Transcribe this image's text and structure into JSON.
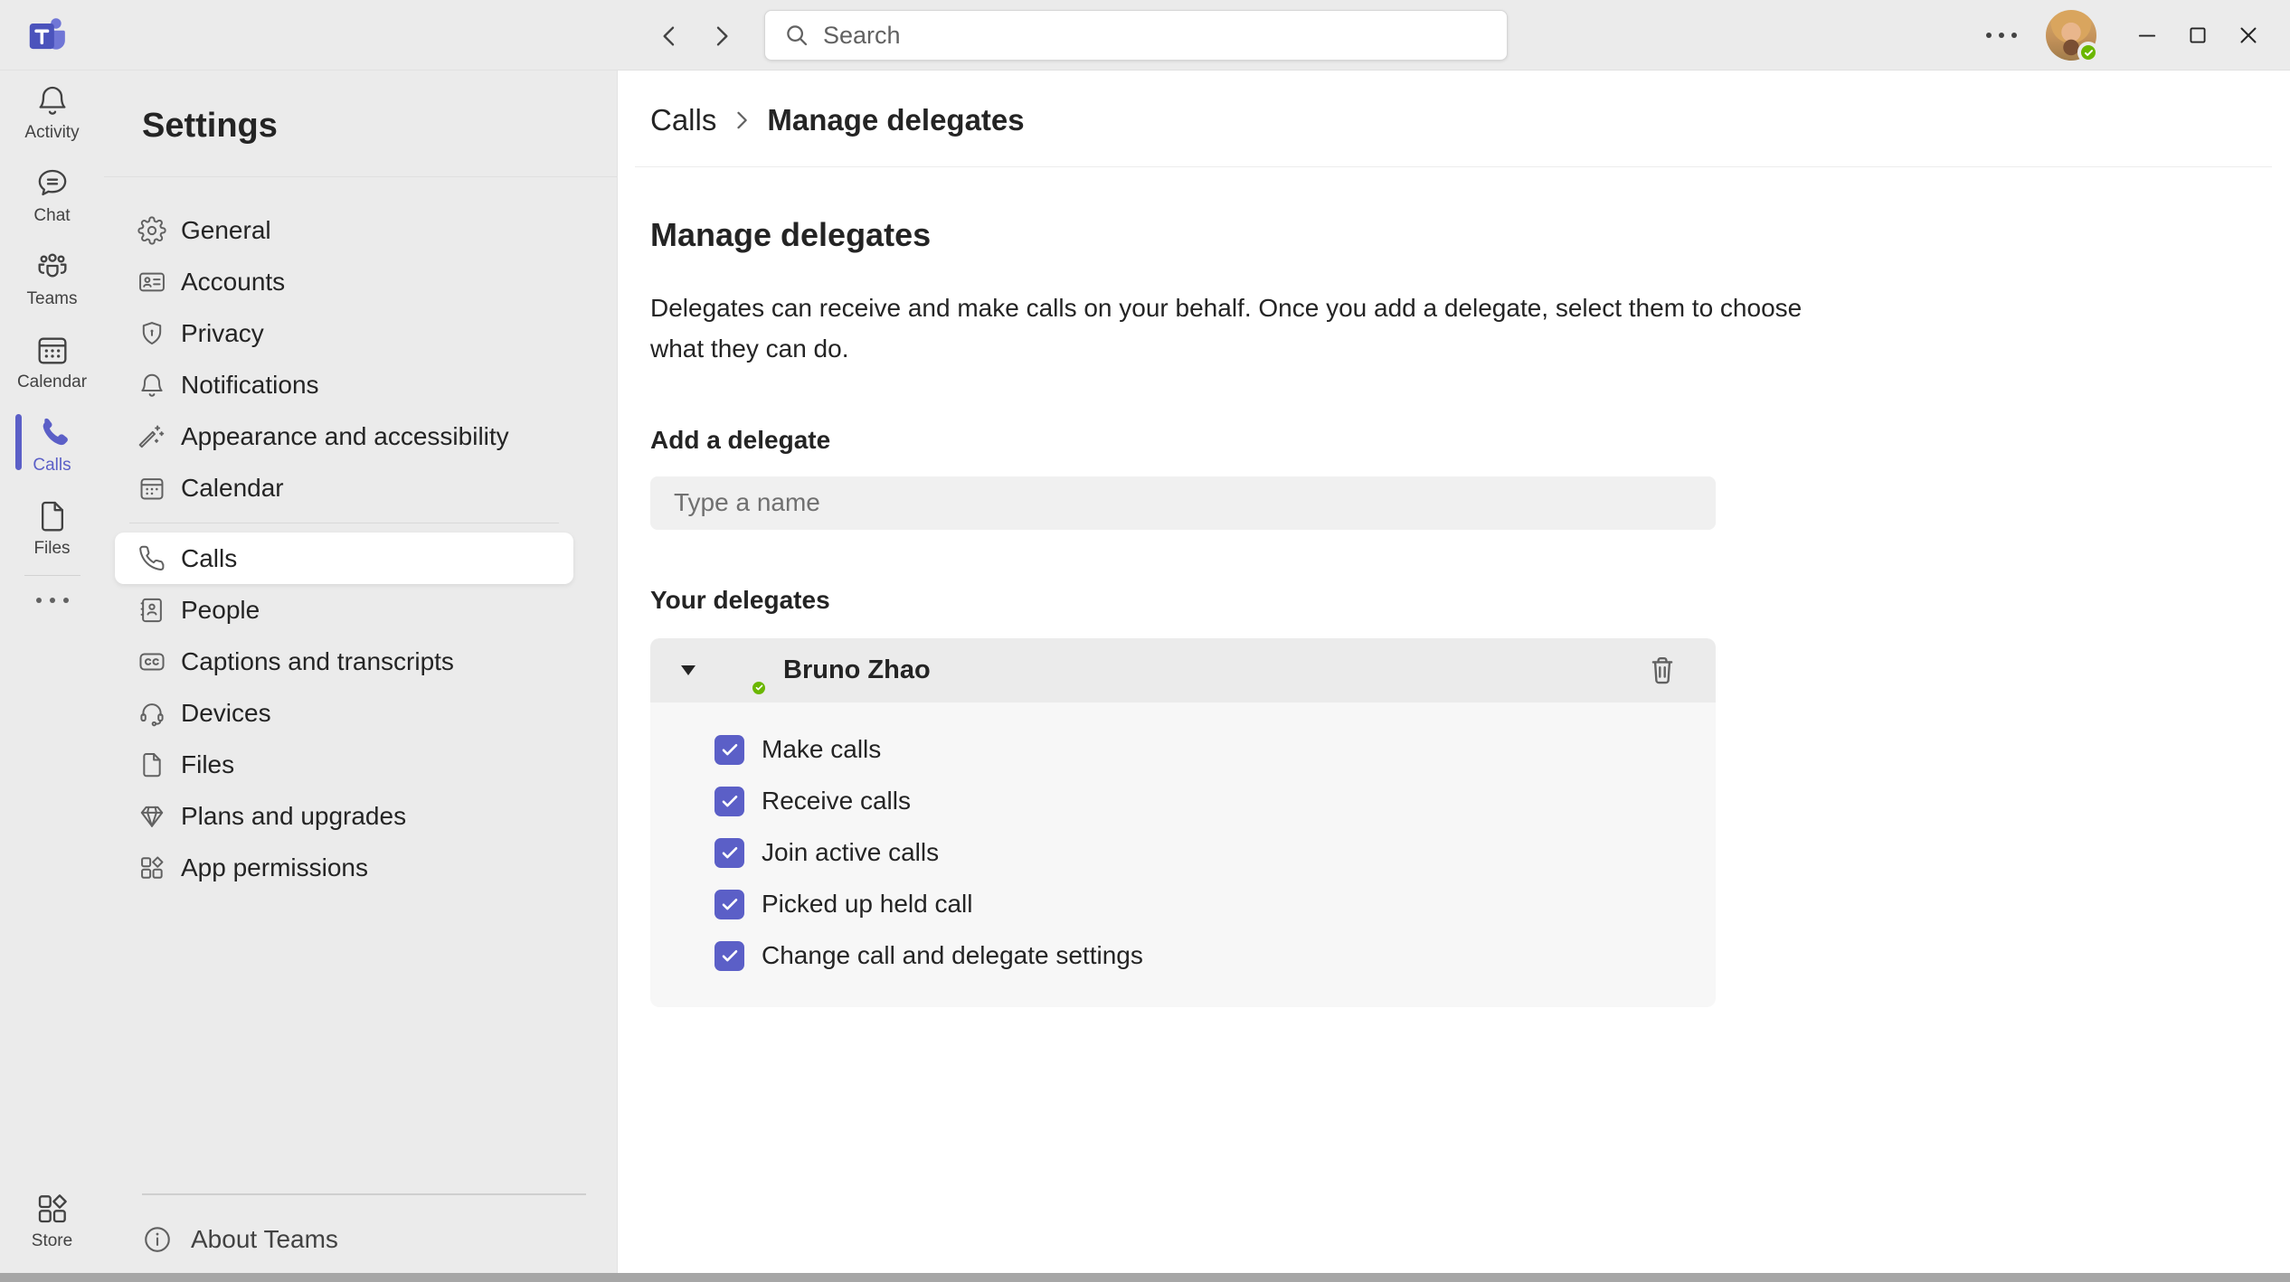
{
  "topbar": {
    "search_placeholder": "Search",
    "search_value": ""
  },
  "rail": {
    "items": [
      {
        "label": "Activity",
        "icon": "bell-icon",
        "active": false
      },
      {
        "label": "Chat",
        "icon": "chat-bubble-icon",
        "active": false
      },
      {
        "label": "Teams",
        "icon": "people-group-icon",
        "active": false
      },
      {
        "label": "Calendar",
        "icon": "calendar-icon",
        "active": false
      },
      {
        "label": "Calls",
        "icon": "phone-filled-icon",
        "active": true
      },
      {
        "label": "Files",
        "icon": "document-icon",
        "active": false
      }
    ],
    "store_label": "Store"
  },
  "settings": {
    "title": "Settings",
    "nav_primary": [
      {
        "label": "General",
        "icon": "gear-icon"
      },
      {
        "label": "Accounts",
        "icon": "id-card-icon"
      },
      {
        "label": "Privacy",
        "icon": "shield-keyhole-icon"
      },
      {
        "label": "Notifications",
        "icon": "bell-icon"
      },
      {
        "label": "Appearance and accessibility",
        "icon": "wand-sparkles-icon"
      },
      {
        "label": "Calendar",
        "icon": "calendar-icon"
      }
    ],
    "nav_secondary": [
      {
        "label": "Calls",
        "icon": "phone-icon",
        "active": true
      },
      {
        "label": "People",
        "icon": "contact-book-icon"
      },
      {
        "label": "Captions and transcripts",
        "icon": "closed-captions-icon"
      },
      {
        "label": "Devices",
        "icon": "headset-icon"
      },
      {
        "label": "Files",
        "icon": "document-icon"
      },
      {
        "label": "Plans and upgrades",
        "icon": "diamond-icon"
      },
      {
        "label": "App permissions",
        "icon": "app-grid-icon"
      }
    ],
    "about_label": "About Teams"
  },
  "main": {
    "breadcrumb": {
      "parent": "Calls",
      "current": "Manage delegates"
    },
    "title": "Manage delegates",
    "description_lines": [
      "Delegates can receive and make calls on your behalf. Once you add a delegate, select them to choose",
      "what they can do."
    ],
    "add_section": {
      "label": "Add a delegate",
      "placeholder": "Type a name",
      "value": ""
    },
    "delegates_section": {
      "label": "Your delegates",
      "delegate": {
        "name": "Bruno Zhao",
        "presence": "available",
        "expanded": true,
        "permissions": [
          {
            "label": "Make calls",
            "checked": true
          },
          {
            "label": "Receive calls",
            "checked": true
          },
          {
            "label": "Join active calls",
            "checked": true
          },
          {
            "label": "Picked up held call",
            "checked": true
          },
          {
            "label": "Change call and delegate settings",
            "checked": true
          }
        ]
      }
    }
  },
  "colors": {
    "accent": "#5b5fc7",
    "presence_available": "#6bb700",
    "chrome_bg": "#ebebeb",
    "main_bg": "#ffffff",
    "card_header_bg": "#ebebeb",
    "card_body_bg": "#f7f7f7"
  }
}
